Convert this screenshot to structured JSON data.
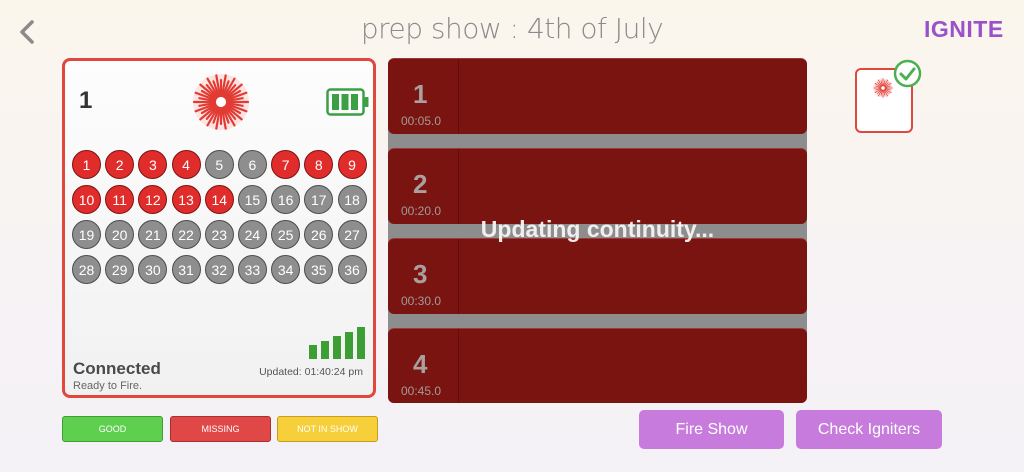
{
  "header": {
    "title": "prep show : 4th of July",
    "logo": "IGNITE",
    "back_icon": "chevron-left-icon"
  },
  "module": {
    "number": "1",
    "status": "Connected",
    "substatus": "Ready to Fire.",
    "updated": "Updated: 01:40:24 pm",
    "battery_level": 1.0,
    "signal_bars": 5,
    "accent_color": "#e0473d",
    "cues": [
      {
        "n": "1",
        "state": "red"
      },
      {
        "n": "2",
        "state": "red"
      },
      {
        "n": "3",
        "state": "red"
      },
      {
        "n": "4",
        "state": "red"
      },
      {
        "n": "5",
        "state": "gray"
      },
      {
        "n": "6",
        "state": "gray"
      },
      {
        "n": "7",
        "state": "red"
      },
      {
        "n": "8",
        "state": "red"
      },
      {
        "n": "9",
        "state": "red"
      },
      {
        "n": "10",
        "state": "red"
      },
      {
        "n": "11",
        "state": "red"
      },
      {
        "n": "12",
        "state": "red"
      },
      {
        "n": "13",
        "state": "red"
      },
      {
        "n": "14",
        "state": "red"
      },
      {
        "n": "15",
        "state": "gray"
      },
      {
        "n": "16",
        "state": "gray"
      },
      {
        "n": "17",
        "state": "gray"
      },
      {
        "n": "18",
        "state": "gray"
      },
      {
        "n": "19",
        "state": "gray"
      },
      {
        "n": "20",
        "state": "gray"
      },
      {
        "n": "21",
        "state": "gray"
      },
      {
        "n": "22",
        "state": "gray"
      },
      {
        "n": "23",
        "state": "gray"
      },
      {
        "n": "24",
        "state": "gray"
      },
      {
        "n": "25",
        "state": "gray"
      },
      {
        "n": "26",
        "state": "gray"
      },
      {
        "n": "27",
        "state": "gray"
      },
      {
        "n": "28",
        "state": "gray"
      },
      {
        "n": "29",
        "state": "gray"
      },
      {
        "n": "30",
        "state": "gray"
      },
      {
        "n": "31",
        "state": "gray"
      },
      {
        "n": "32",
        "state": "gray"
      },
      {
        "n": "33",
        "state": "gray"
      },
      {
        "n": "34",
        "state": "gray"
      },
      {
        "n": "35",
        "state": "gray"
      },
      {
        "n": "36",
        "state": "gray"
      }
    ]
  },
  "legend": {
    "good": "GOOD",
    "missing": "MISSING",
    "not_in_show": "NOT IN SHOW"
  },
  "timeline": {
    "overlay": "Updating continuity...",
    "rows": [
      {
        "num": "1",
        "time": "00:05.0"
      },
      {
        "num": "2",
        "time": "00:20.0"
      },
      {
        "num": "3",
        "time": "00:30.0"
      },
      {
        "num": "4",
        "time": "00:45.0"
      }
    ]
  },
  "actions": {
    "fire_show": "Fire Show",
    "check_igniters": "Check Igniters"
  },
  "colors": {
    "button": "#c77bdc",
    "cue_row": "#7a1410",
    "good": "#5fcf4f",
    "missing": "#e04848",
    "not_in_show": "#f6cf3a"
  }
}
